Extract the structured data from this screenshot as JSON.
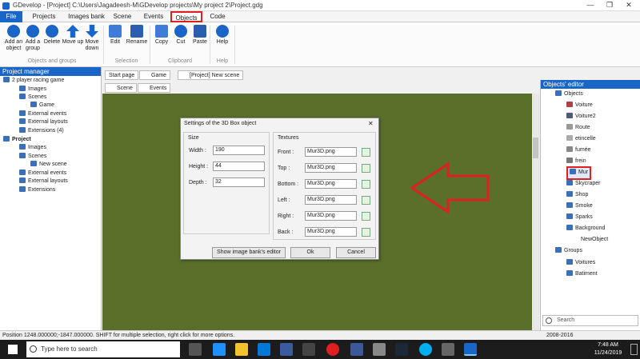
{
  "window": {
    "title": "GDevelop - [Project] C:\\Users\\Jagadeesh-M\\GDevelop projects\\My project 2\\Project.gdg",
    "minimize": "—",
    "maximize": "❐",
    "close": "✕"
  },
  "menu": [
    "File",
    "Projects",
    "Images bank",
    "Scene",
    "Events",
    "Objects",
    "Code"
  ],
  "ribbon": {
    "buttons": [
      "Add an object",
      "Add a group",
      "Delete",
      "Move up",
      "Move down",
      "Edit",
      "Rename",
      "Copy",
      "Cut",
      "Paste",
      "Help"
    ],
    "groups": [
      "Objects and groups",
      "Selection",
      "Clipboard",
      "Help"
    ]
  },
  "project_manager": {
    "title": "Project manager",
    "items": [
      "2 player racing game",
      "Images",
      "Scenes",
      "Game",
      "External events",
      "External layouts",
      "Extensions (4)",
      "Project",
      "Images",
      "Scenes",
      "New scene",
      "External events",
      "External layouts",
      "Extensions"
    ]
  },
  "tabs": [
    "Start page",
    "Game",
    "[Project] New scene"
  ],
  "subtabs": [
    "Scene",
    "Events"
  ],
  "dialog": {
    "title": "Settings of the 3D Box object",
    "size_label": "Size",
    "width_label": "Width :",
    "width_value": "190",
    "height_label": "Height :",
    "height_value": "44",
    "depth_label": "Depth :",
    "depth_value": "32",
    "textures_label": "Textures",
    "faces": [
      {
        "label": "Front :",
        "value": "Mur3D.png"
      },
      {
        "label": "Top :",
        "value": "Mur3D.png"
      },
      {
        "label": "Bottom :",
        "value": "Mur3D.png"
      },
      {
        "label": "Left :",
        "value": "Mur3D.png"
      },
      {
        "label": "Right :",
        "value": "Mur3D.png"
      },
      {
        "label": "Back :",
        "value": "Mur3D.png"
      }
    ],
    "show_bank": "Show image bank's editor",
    "ok": "Ok",
    "cancel": "Cancel",
    "close": "✕"
  },
  "objects_editor": {
    "title": "Objects' editor",
    "root": "Objects",
    "objects": [
      "Voiture",
      "Voiture2",
      "Route",
      "etincelle",
      "fumée",
      "frein",
      "Mur",
      "Skycraper",
      "Shop",
      "Smoke",
      "Sparks",
      "Background",
      "NewObject"
    ],
    "groups_label": "Groups",
    "groups": [
      "Voitures",
      "Batiment"
    ],
    "search_placeholder": "Search"
  },
  "status": {
    "left": "Position 1248.000000;-1847.000000. SHIFT for multiple selection, right click for more options.",
    "right": "2008-2016"
  },
  "taskbar": {
    "search_placeholder": "Type here to search",
    "time": "7:48 AM",
    "date": "11/24/2019"
  },
  "colors": {
    "accent": "#1a66c8",
    "canvas": "#596f2a",
    "highlight": "#e02020"
  }
}
